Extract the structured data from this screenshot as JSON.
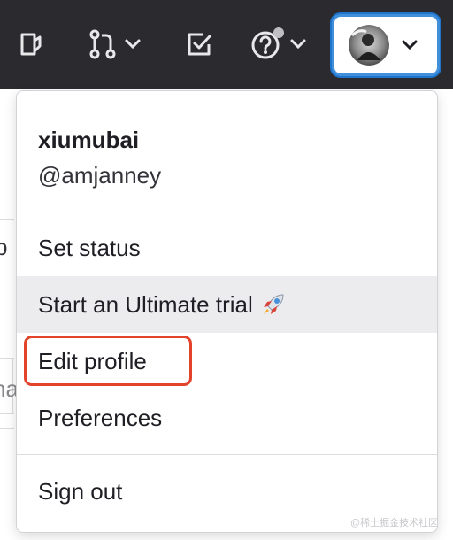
{
  "navbar": {
    "icons": [
      "issues-icon",
      "merge-requests-icon",
      "todos-icon",
      "help-icon",
      "avatar"
    ],
    "help_has_notification": true
  },
  "background": {
    "fragments": [
      "p",
      "na"
    ]
  },
  "user_menu": {
    "name": "xiumubai",
    "username": "@amjanney",
    "items": [
      {
        "label": "Set status"
      },
      {
        "label": "Start an Ultimate trial",
        "emoji": "🚀",
        "hovered": true
      },
      {
        "label": "Edit profile",
        "highlighted": true
      },
      {
        "label": "Preferences"
      },
      {
        "label": "Sign out"
      }
    ]
  },
  "colors": {
    "navbar_bg": "#2a2a2f",
    "focus_ring": "#428fdc",
    "highlight_box": "#e2432a",
    "hover_bg": "#ececef"
  },
  "watermark": "@稀土掘金技术社区"
}
